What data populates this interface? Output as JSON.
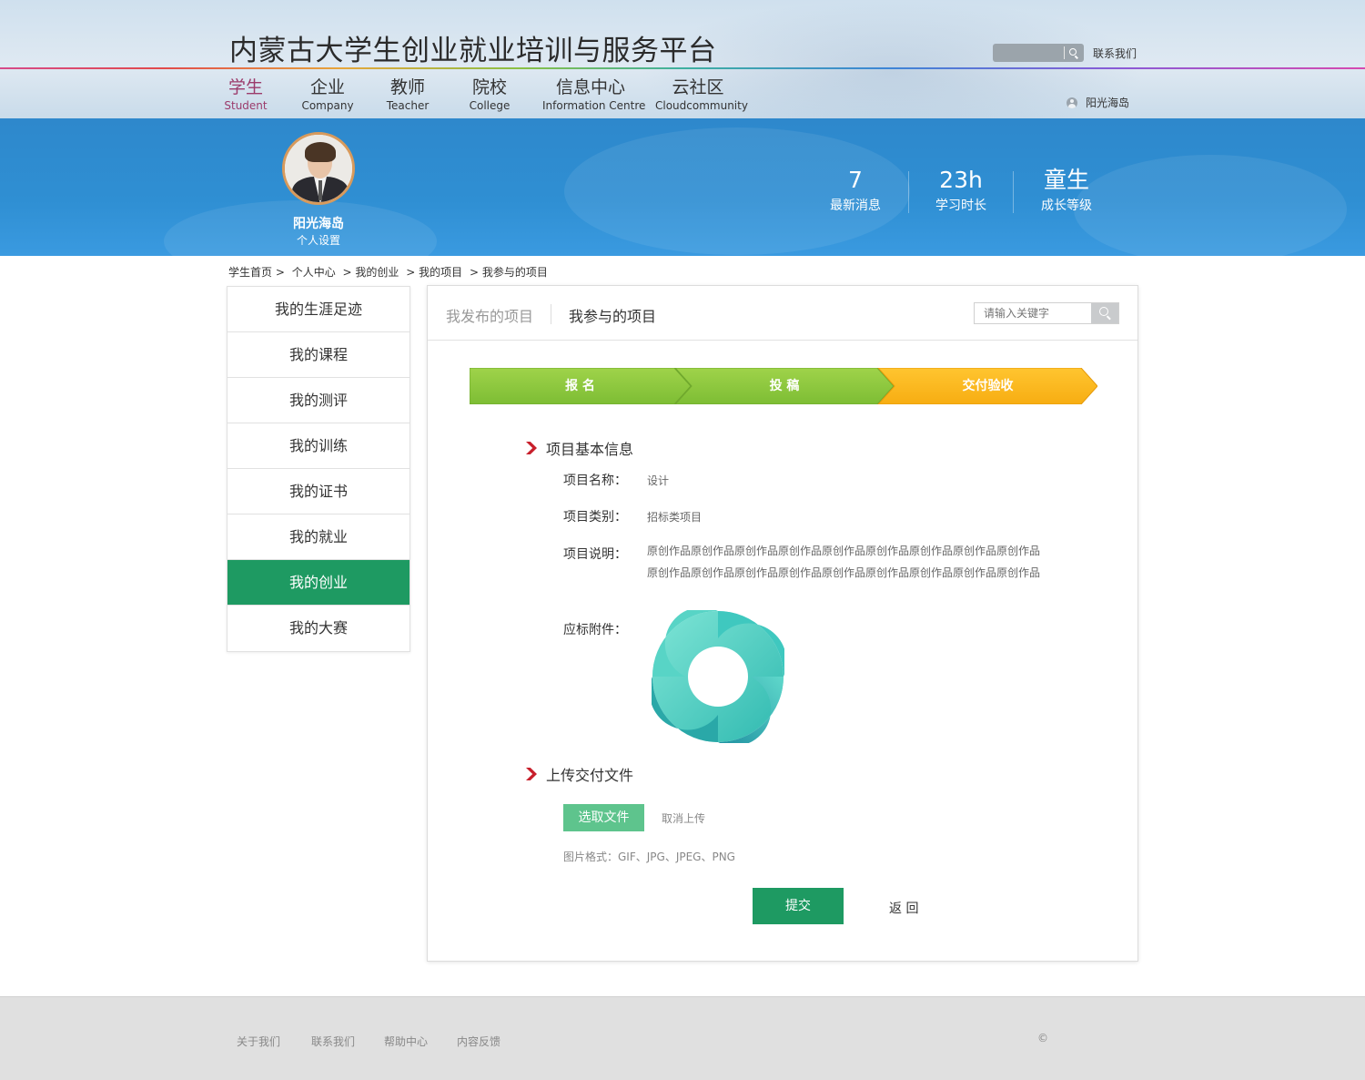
{
  "header": {
    "site_title": "内蒙古大学生创业就业培训与服务平台",
    "contact": "联系我们",
    "username": "阳光海岛"
  },
  "nav": [
    {
      "cn": "学生",
      "en": "Student",
      "active": true
    },
    {
      "cn": "企业",
      "en": "Company"
    },
    {
      "cn": "教师",
      "en": "Teacher"
    },
    {
      "cn": "院校",
      "en": "College"
    },
    {
      "cn": "信息中心",
      "en": "Information Centre"
    },
    {
      "cn": "云社区",
      "en": "Cloudcommunity"
    }
  ],
  "profile": {
    "name": "阳光海岛",
    "settings": "个人设置"
  },
  "stats": [
    {
      "value": "7",
      "label": "最新消息"
    },
    {
      "value": "23h",
      "label": "学习时长"
    },
    {
      "value": "童生",
      "label": "成长等级"
    }
  ],
  "breadcrumb": [
    "学生首页 >",
    "个人中心",
    "> 我的创业",
    "> 我的项目",
    "> 我参与的项目"
  ],
  "sidebar": [
    {
      "label": "我的生涯足迹"
    },
    {
      "label": "我的课程"
    },
    {
      "label": "我的测评"
    },
    {
      "label": "我的训练"
    },
    {
      "label": "我的证书"
    },
    {
      "label": "我的就业"
    },
    {
      "label": "我的创业",
      "active": true
    },
    {
      "label": "我的大赛"
    }
  ],
  "tabs": {
    "published": "我发布的项目",
    "participated": "我参与的项目"
  },
  "search": {
    "placeholder": "请输入关键字"
  },
  "steps": [
    {
      "label": "报 名",
      "color": "#8cc63f"
    },
    {
      "label": "投 稿",
      "color": "#8cc63f"
    },
    {
      "label": "交付验收",
      "color": "#fbb117"
    }
  ],
  "section_basic": {
    "title": "项目基本信息",
    "name_label": "项目名称：",
    "name_value": "设计",
    "type_label": "项目类别：",
    "type_value": "招标类项目",
    "desc_label": "项目说明：",
    "desc_line1": "原创作品原创作品原创作品原创作品原创作品原创作品原创作品原创作品原创作品",
    "desc_line2": "原创作品原创作品原创作品原创作品原创作品原创作品原创作品原创作品原创作品",
    "attachment_label": "应标附件："
  },
  "section_upload": {
    "title": "上传交付文件",
    "choose_label": "选取文件",
    "cancel_label": "取消上传",
    "format_note": "图片格式：GIF、JPG、JPEG、PNG"
  },
  "actions": {
    "submit": "提交",
    "back": "返 回"
  },
  "footer": {
    "links": [
      "关于我们",
      "联系我们",
      "帮助中心",
      "内容反馈"
    ],
    "copyright": "©"
  },
  "colors": {
    "accent_green": "#1e9a62",
    "banner_blue": "#2f8fd3",
    "step_green": "#8cc63f",
    "step_orange": "#fbb117",
    "nav_active": "#9b3b6b"
  }
}
